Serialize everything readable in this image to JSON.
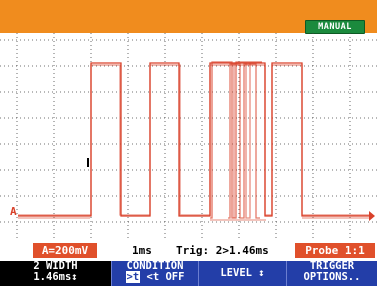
{
  "device_mode": "MANUAL",
  "channel_marker": "A",
  "status": {
    "channel_range": "A=200mV",
    "timebase": "1ms",
    "trigger": "Trig: 2>1.46ms",
    "probe": "Probe 1:1"
  },
  "softkeys": [
    {
      "line1": "2 WIDTH",
      "line2": "1.46ms↕"
    },
    {
      "line1": "CONDITION",
      "line2_hl": ">t",
      "line2_rest": " <t  OFF"
    },
    {
      "line1": "LEVEL ↕",
      "line2": ""
    },
    {
      "line1": "TRIGGER",
      "line2": "OPTIONS.."
    }
  ],
  "colors": {
    "accent": "#f08c1e",
    "trace": "#d9412a",
    "softkey_bg": "#233ea8",
    "badge": "#e0502b",
    "mode_badge": "#1b8a3d"
  }
}
